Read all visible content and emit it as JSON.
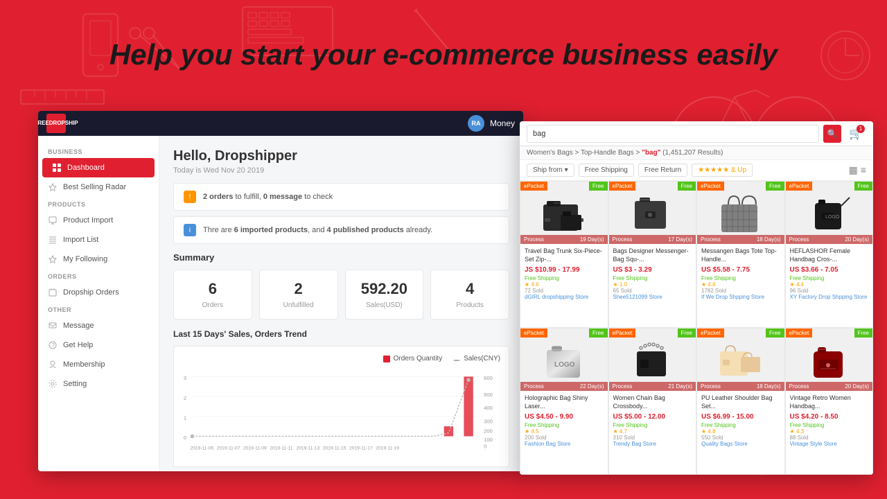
{
  "headline": "Help you start your e-commerce business easily",
  "dashboard": {
    "topbar": {
      "logo_line1": "FREE",
      "logo_line2": "DROPSHIP",
      "user_initials": "RA",
      "user_name": "Money"
    },
    "greeting": "Hello, Dropshipper",
    "date": "Today is Wed Nov 20 2019",
    "alerts": [
      {
        "type": "warning",
        "text": "2 orders to fulfill, 0 message to check"
      },
      {
        "type": "info",
        "text": "Thre are 6 imported products, and 4 published products already."
      }
    ],
    "summary_title": "Summary",
    "summary_cards": [
      {
        "value": "6",
        "label": "Orders"
      },
      {
        "value": "2",
        "label": "Unfulfilled"
      },
      {
        "value": "592.20",
        "label": "Sales(USD)"
      },
      {
        "value": "4",
        "label": "Products"
      }
    ],
    "chart_title": "Last 15 Days' Sales, Orders Trend",
    "chart_legend": [
      {
        "label": "Orders Quantity",
        "color": "#e02030"
      },
      {
        "label": "Sales(CNY)",
        "color": "#999"
      }
    ],
    "sidebar": {
      "sections": [
        {
          "label": "BUSINESS",
          "items": [
            {
              "id": "dashboard",
              "label": "Dashboard",
              "active": true
            },
            {
              "id": "best-selling",
              "label": "Best Selling Radar",
              "active": false
            }
          ]
        },
        {
          "label": "PRODUCTS",
          "items": [
            {
              "id": "product-import",
              "label": "Product Import",
              "active": false
            },
            {
              "id": "import-list",
              "label": "Import List",
              "active": false
            },
            {
              "id": "my-following",
              "label": "My Following",
              "active": false
            }
          ]
        },
        {
          "label": "ORDERS",
          "items": [
            {
              "id": "dropship-orders",
              "label": "Dropship Orders",
              "active": false
            }
          ]
        },
        {
          "label": "OTHER",
          "items": [
            {
              "id": "message",
              "label": "Message",
              "active": false
            },
            {
              "id": "get-help",
              "label": "Get Help",
              "active": false
            },
            {
              "id": "membership",
              "label": "Membership",
              "active": false
            },
            {
              "id": "setting",
              "label": "Setting",
              "active": false
            }
          ]
        }
      ]
    }
  },
  "ecommerce": {
    "search_value": "bag",
    "breadcrumb": "Women's Bags > Top-Handle Bags > \"bag\" (1,451,207 Results)",
    "filters": {
      "ship_from": "Ship from",
      "free_shipping": "Free Shipping",
      "free_return": "Free Return",
      "stars": "★★★★★ & Up"
    },
    "products": [
      {
        "badge_type": "ePacket",
        "badge_free": true,
        "title": "Travel Bag Trunk Six-Piece-Set Zip-...",
        "price": "JS $10.99 - 17.99",
        "shipping": "Free Shipping",
        "rating": "4.6",
        "sold": "72 Sold",
        "store": "dGIRL dropshipping Store",
        "process_days": "19 Day(s)",
        "color": "#2a2a2a"
      },
      {
        "badge_type": "ePacket",
        "badge_free": true,
        "title": "Bags Designer Messenger-Bag Squ-...",
        "price": "US $3 - 3.29",
        "shipping": "Free Shipping",
        "rating": "★ 1.0",
        "sold": "65 Sold",
        "store": "Shee5121099 Store",
        "process_days": "17 Day(s)",
        "color": "#3a3a3a"
      },
      {
        "badge_type": "ePacket",
        "badge_free": true,
        "title": "Messangen Bags Tote Top-Handle...",
        "price": "US $5.58 - 7.75",
        "shipping": "Free Shipping",
        "rating": "4.6",
        "sold": "1782 Sold",
        "store": "If We Drop Shpping Store",
        "process_days": "18 Day(s)",
        "color": "#808080"
      },
      {
        "badge_type": "ePacket",
        "badge_free": true,
        "title": "HEFLASHOR Female Handbag Cros-...",
        "price": "US $3.66 - 7.05",
        "shipping": "Free Shipping",
        "rating": "4.4",
        "sold": "96 Sold",
        "store": "XY Factory Drop Shpping Store",
        "process_days": "20 Day(s)",
        "color": "#1a1a1a"
      },
      {
        "badge_type": "ePacket",
        "badge_free": true,
        "title": "Holographic Bag Shiny Laser...",
        "price": "US $4.50 - 9.90",
        "shipping": "Free Shipping",
        "rating": "4.5",
        "sold": "200 Sold",
        "store": "Fashion Bag Store",
        "process_days": "22 Day(s)",
        "color": "#silver"
      },
      {
        "badge_type": "ePacket",
        "badge_free": true,
        "title": "Women Chain Bag Crossbody...",
        "price": "US $5.00 - 12.00",
        "shipping": "Free Shipping",
        "rating": "4.7",
        "sold": "310 Sold",
        "store": "Trendy Bag Store",
        "process_days": "21 Day(s)",
        "color": "#2a2a2a"
      },
      {
        "badge_type": "ePacket",
        "badge_free": true,
        "title": "PU Leather Shoulder Bag Set...",
        "price": "US $6.99 - 15.00",
        "shipping": "Free Shipping",
        "rating": "4.8",
        "sold": "550 Sold",
        "store": "Quality Bags Store",
        "process_days": "18 Day(s)",
        "color": "#f5deb3"
      },
      {
        "badge_type": "ePacket",
        "badge_free": true,
        "title": "Vintage Retro Women Handbag...",
        "price": "US $4.20 - 8.50",
        "shipping": "Free Shipping",
        "rating": "4.3",
        "sold": "88 Sold",
        "store": "Vintage Style Store",
        "process_days": "20 Day(s)",
        "color": "#8b0000"
      }
    ]
  }
}
